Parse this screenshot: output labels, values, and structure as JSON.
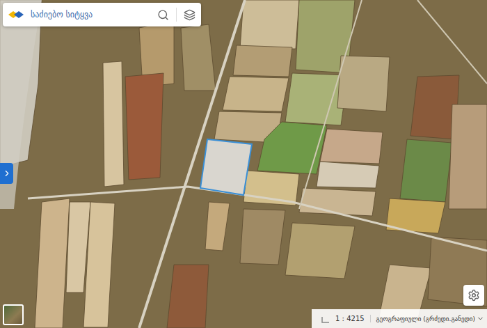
{
  "search": {
    "placeholder": "საძიებო სიტყვა"
  },
  "sidebar_toggle": {
    "expanded": false
  },
  "scale": {
    "label": "1 : 4215"
  },
  "projection": {
    "label": "გეოგრაფიული (გრძედი.განედი)"
  }
}
